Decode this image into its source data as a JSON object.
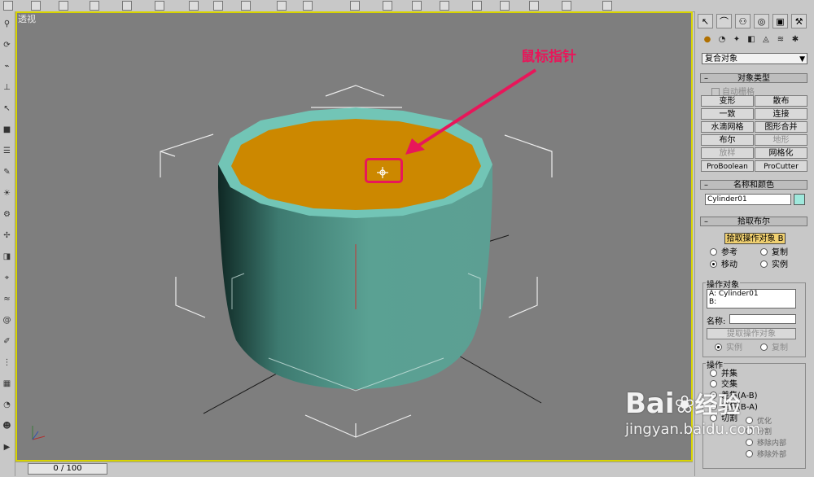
{
  "viewport": {
    "label": "透视"
  },
  "annotation": {
    "text": "鼠标指针"
  },
  "timeline": {
    "frame_display": "0 / 100"
  },
  "command_panel": {
    "category_dropdown": "复合对象",
    "object_type": {
      "title": "对象类型",
      "auto_grid": "自动栅格",
      "buttons": [
        "变形",
        "散布",
        "一致",
        "连接",
        "水滴网格",
        "图形合并",
        "布尔",
        "地形",
        "放样",
        "网格化",
        "ProBoolean",
        "ProCutter"
      ]
    },
    "name_color": {
      "title": "名称和颜色",
      "object_name": "Cylinder01",
      "swatch_color": "#9fe8dc"
    },
    "pick_boolean": {
      "title": "拾取布尔",
      "pick_button": "拾取操作对象 B",
      "radio_reference": "参考",
      "radio_copy": "复制",
      "radio_move": "移动",
      "radio_instance": "实例"
    },
    "operands": {
      "title": "操作对象",
      "line_a": "A: Cylinder01",
      "line_b": "B:",
      "name_label": "名称:",
      "extract_button": "提取操作对象",
      "radio_instance": "实例",
      "radio_copy": "复制"
    },
    "operation": {
      "title": "操作",
      "union": "并集",
      "intersection": "交集",
      "subtract_ab": "差集(A-B)",
      "subtract_ba": "差集(B-A)",
      "cut_option_1": "切割",
      "cut_option_2": "优化",
      "cut_option_3": "分割",
      "cut_option_4": "移除内部",
      "cut_option_5": "移除外部"
    }
  },
  "watermark": {
    "brand": "Bai",
    "brand2": "经验",
    "url": "jingyan.baidu.com"
  },
  "colors": {
    "viewport_bg": "#7e7e7e",
    "active_border": "#d8d400",
    "cylinder_top": "#cc8800",
    "cylinder_side": "#5aa193",
    "annotation": "#e8165a"
  }
}
